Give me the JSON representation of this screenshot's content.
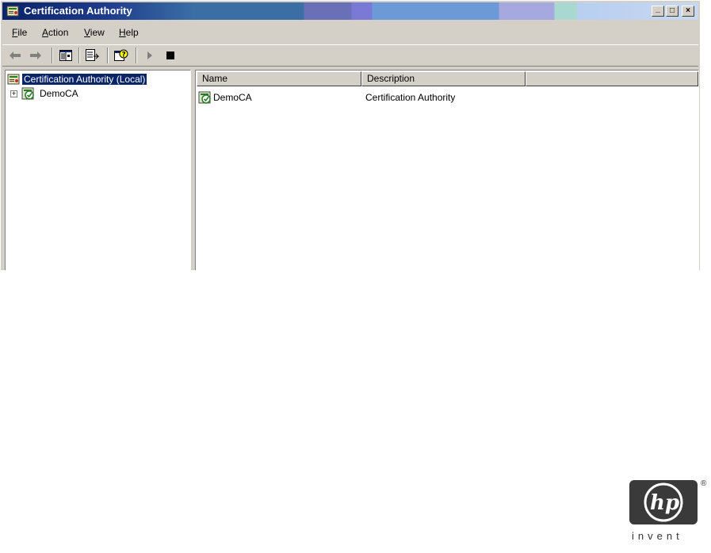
{
  "window": {
    "title": "Certification Authority",
    "buttons": [
      "_",
      "□",
      "×"
    ]
  },
  "menu": [
    {
      "label": "File",
      "u": "F",
      "rest": "ile"
    },
    {
      "label": "Action",
      "u": "A",
      "rest": "ction"
    },
    {
      "label": "View",
      "u": "V",
      "rest": "iew"
    },
    {
      "label": "Help",
      "u": "H",
      "rest": "elp"
    }
  ],
  "toolbar": {
    "icons": [
      "back-arrow-icon",
      "forward-arrow-icon",
      "show-hide-console-tree-icon",
      "export-list-icon",
      "help-icon",
      "start-service-icon",
      "stop-service-icon"
    ]
  },
  "tree": {
    "root_label": "Certification Authority (Local)",
    "child_label": "DemoCA",
    "expander": "+"
  },
  "list": {
    "columns": [
      "Name",
      "Description"
    ],
    "rows": [
      {
        "name": "DemoCA",
        "description": "Certification Authority"
      }
    ]
  },
  "branding": {
    "logo_text": "hp",
    "tagline": "invent",
    "reg_mark": "®"
  }
}
